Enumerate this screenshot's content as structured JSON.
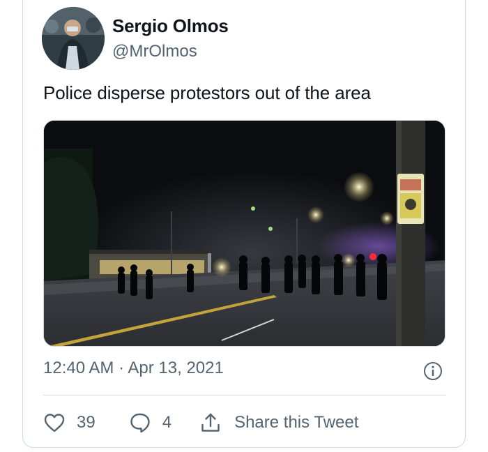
{
  "author": {
    "display_name": "Sergio Olmos",
    "handle": "@MrOlmos",
    "avatar_icon": "avatar-photo"
  },
  "tweet": {
    "text": "Police disperse protestors out of the area",
    "media_icon": "video-still-night-street",
    "timestamp": "12:40 AM · Apr 13, 2021"
  },
  "actions": {
    "like_count": "39",
    "reply_count": "4",
    "share_label": "Share this Tweet"
  },
  "colors": {
    "text_primary": "#0f1419",
    "text_secondary": "#536471",
    "border": "#cfd9de"
  }
}
